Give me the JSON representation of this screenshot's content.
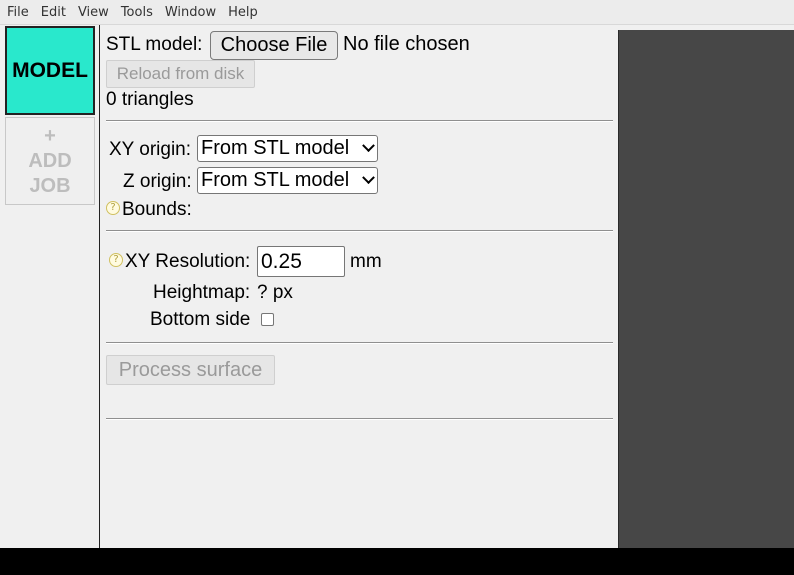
{
  "menu": {
    "items": [
      "File",
      "Edit",
      "View",
      "Tools",
      "Window",
      "Help"
    ]
  },
  "sidebar": {
    "model_tab": "MODEL",
    "add_job": {
      "plus": "+",
      "line1": "ADD",
      "line2": "JOB"
    }
  },
  "model_panel": {
    "stl_label": "STL model:",
    "choose_file": "Choose File",
    "no_file": "No file chosen",
    "reload": "Reload from disk",
    "triangles": "0 triangles",
    "xy_origin_label": "XY origin:",
    "xy_origin_value": "From STL model",
    "z_origin_label": "Z origin:",
    "z_origin_value": "From STL model",
    "help_glyph": "?",
    "bounds_label": "Bounds:",
    "xy_resolution_label": "XY Resolution:",
    "xy_resolution_value": "0.25",
    "xy_resolution_unit": "mm",
    "heightmap_label": "Heightmap:",
    "heightmap_value": "? px",
    "bottom_side_label": "Bottom side",
    "bottom_side_checked": false,
    "process_button": "Process surface"
  },
  "colors": {
    "model_tab_bg": "#29e8cc",
    "viewport_bg": "#474747"
  }
}
